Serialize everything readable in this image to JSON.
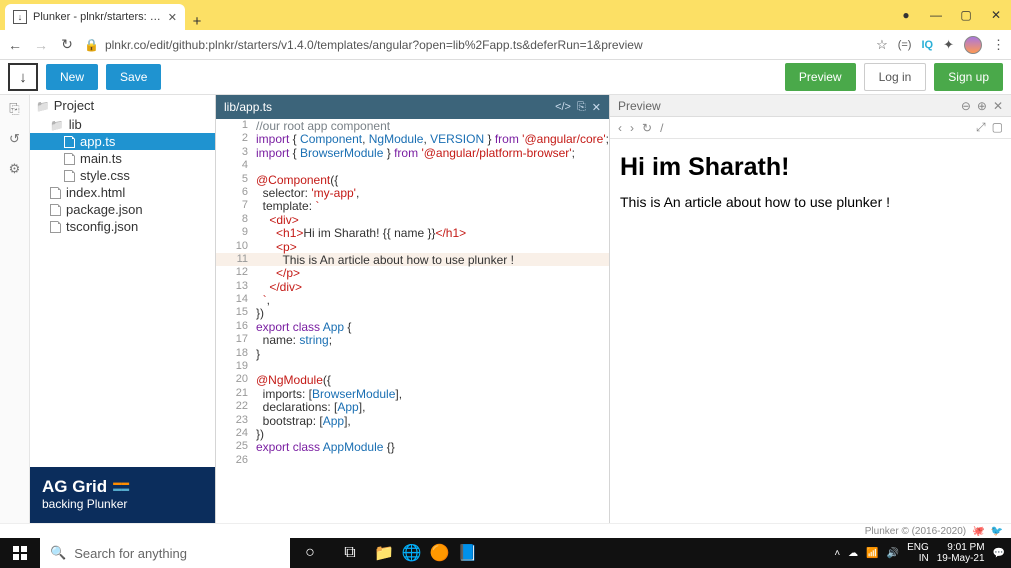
{
  "browser": {
    "tab_title": "Plunker - plnkr/starters: Starter te",
    "url": "plnkr.co/edit/github:plnkr/starters/v1.4.0/templates/angular?open=lib%2Fapp.ts&deferRun=1&preview",
    "iq_label": "IQ"
  },
  "header": {
    "new": "New",
    "save": "Save",
    "preview": "Preview",
    "login": "Log in",
    "signup": "Sign up"
  },
  "sidebar": {
    "project": "Project",
    "lib": "lib",
    "files": {
      "app": "app.ts",
      "main": "main.ts",
      "style": "style.css",
      "index": "index.html",
      "package": "package.json",
      "tsconfig": "tsconfig.json"
    },
    "ag_title": "AG Grid",
    "ag_sub": "backing Plunker"
  },
  "editor": {
    "tab": "lib/app.ts",
    "lines": [
      {
        "n": 1,
        "html": "<span class='c-cm'>//our root app component</span>"
      },
      {
        "n": 2,
        "html": "<span class='c-kw'>import</span> { <span class='c-id'>Component</span>, <span class='c-id'>NgModule</span>, <span class='c-id'>VERSION</span> } <span class='c-kw'>from</span> <span class='c-str'>'@angular/core'</span>;"
      },
      {
        "n": 3,
        "html": "<span class='c-kw'>import</span> { <span class='c-id'>BrowserModule</span> } <span class='c-kw'>from</span> <span class='c-str'>'@angular/platform-browser'</span>;"
      },
      {
        "n": 4,
        "html": ""
      },
      {
        "n": 5,
        "html": "<span class='c-dec'>@Component</span>({"
      },
      {
        "n": 6,
        "html": "  selector: <span class='c-str'>'my-app'</span>,"
      },
      {
        "n": 7,
        "html": "  template: <span class='c-str'>`</span>"
      },
      {
        "n": 8,
        "html": "    <span class='c-tag'>&lt;div&gt;</span>"
      },
      {
        "n": 9,
        "html": "      <span class='c-tag'>&lt;h1&gt;</span>Hi im Sharath! {{ name }}<span class='c-tag'>&lt;/h1&gt;</span>"
      },
      {
        "n": 10,
        "html": "      <span class='c-tag'>&lt;p&gt;</span>"
      },
      {
        "n": 11,
        "html": "        This is An article about how to use plunker !",
        "hl": true
      },
      {
        "n": 12,
        "html": "      <span class='c-tag'>&lt;/p&gt;</span>"
      },
      {
        "n": 13,
        "html": "    <span class='c-tag'>&lt;/div&gt;</span>"
      },
      {
        "n": 14,
        "html": "  <span class='c-str'>`</span>,"
      },
      {
        "n": 15,
        "html": "})"
      },
      {
        "n": 16,
        "html": "<span class='c-kw'>export</span> <span class='c-kw'>class</span> <span class='c-id'>App</span> {"
      },
      {
        "n": 17,
        "html": "  name: <span class='c-id'>string</span>;"
      },
      {
        "n": 18,
        "html": "}"
      },
      {
        "n": 19,
        "html": ""
      },
      {
        "n": 20,
        "html": "<span class='c-dec'>@NgModule</span>({"
      },
      {
        "n": 21,
        "html": "  imports: [<span class='c-id'>BrowserModule</span>],"
      },
      {
        "n": 22,
        "html": "  declarations: [<span class='c-id'>App</span>],"
      },
      {
        "n": 23,
        "html": "  bootstrap: [<span class='c-id'>App</span>],"
      },
      {
        "n": 24,
        "html": "})"
      },
      {
        "n": 25,
        "html": "<span class='c-kw'>export</span> <span class='c-kw'>class</span> <span class='c-id'>AppModule</span> {}"
      },
      {
        "n": 26,
        "html": ""
      }
    ]
  },
  "preview": {
    "title": "Preview",
    "path": "/",
    "h1": "Hi im Sharath!",
    "p": "This is An article about how to use plunker !"
  },
  "footer": {
    "copy": "Plunker © (2016-2020)"
  },
  "taskbar": {
    "search": "Search for anything",
    "lang1": "ENG",
    "lang2": "IN",
    "time": "9:01 PM",
    "date": "19-May-21"
  }
}
